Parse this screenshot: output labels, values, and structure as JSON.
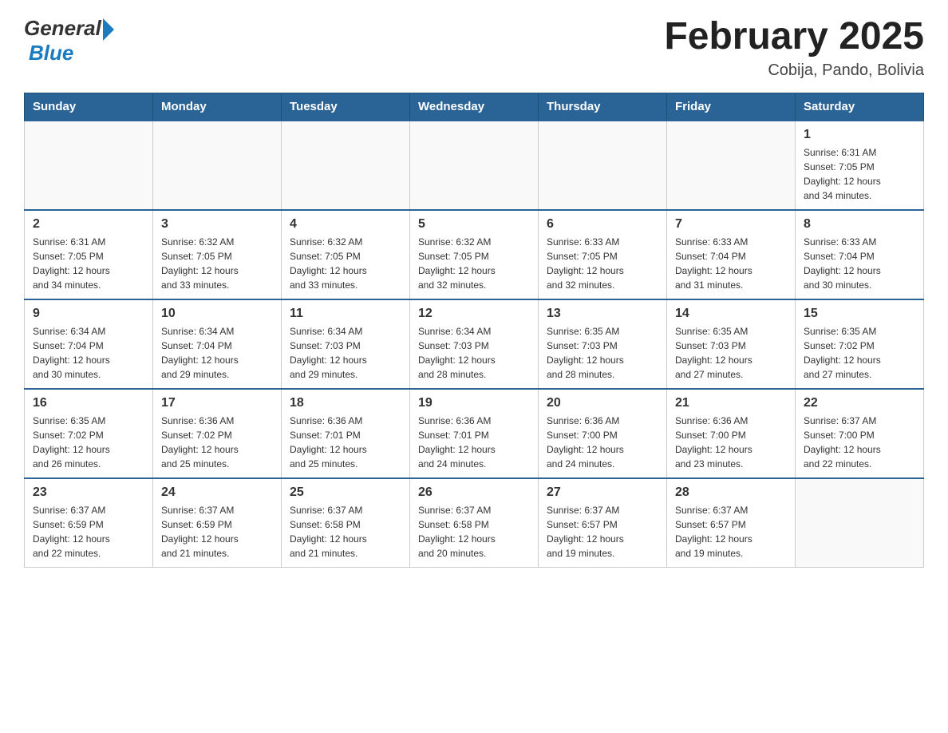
{
  "logo": {
    "general": "General",
    "blue": "Blue"
  },
  "title": "February 2025",
  "subtitle": "Cobija, Pando, Bolivia",
  "weekdays": [
    "Sunday",
    "Monday",
    "Tuesday",
    "Wednesday",
    "Thursday",
    "Friday",
    "Saturday"
  ],
  "weeks": [
    [
      {
        "day": "",
        "info": ""
      },
      {
        "day": "",
        "info": ""
      },
      {
        "day": "",
        "info": ""
      },
      {
        "day": "",
        "info": ""
      },
      {
        "day": "",
        "info": ""
      },
      {
        "day": "",
        "info": ""
      },
      {
        "day": "1",
        "info": "Sunrise: 6:31 AM\nSunset: 7:05 PM\nDaylight: 12 hours\nand 34 minutes."
      }
    ],
    [
      {
        "day": "2",
        "info": "Sunrise: 6:31 AM\nSunset: 7:05 PM\nDaylight: 12 hours\nand 34 minutes."
      },
      {
        "day": "3",
        "info": "Sunrise: 6:32 AM\nSunset: 7:05 PM\nDaylight: 12 hours\nand 33 minutes."
      },
      {
        "day": "4",
        "info": "Sunrise: 6:32 AM\nSunset: 7:05 PM\nDaylight: 12 hours\nand 33 minutes."
      },
      {
        "day": "5",
        "info": "Sunrise: 6:32 AM\nSunset: 7:05 PM\nDaylight: 12 hours\nand 32 minutes."
      },
      {
        "day": "6",
        "info": "Sunrise: 6:33 AM\nSunset: 7:05 PM\nDaylight: 12 hours\nand 32 minutes."
      },
      {
        "day": "7",
        "info": "Sunrise: 6:33 AM\nSunset: 7:04 PM\nDaylight: 12 hours\nand 31 minutes."
      },
      {
        "day": "8",
        "info": "Sunrise: 6:33 AM\nSunset: 7:04 PM\nDaylight: 12 hours\nand 30 minutes."
      }
    ],
    [
      {
        "day": "9",
        "info": "Sunrise: 6:34 AM\nSunset: 7:04 PM\nDaylight: 12 hours\nand 30 minutes."
      },
      {
        "day": "10",
        "info": "Sunrise: 6:34 AM\nSunset: 7:04 PM\nDaylight: 12 hours\nand 29 minutes."
      },
      {
        "day": "11",
        "info": "Sunrise: 6:34 AM\nSunset: 7:03 PM\nDaylight: 12 hours\nand 29 minutes."
      },
      {
        "day": "12",
        "info": "Sunrise: 6:34 AM\nSunset: 7:03 PM\nDaylight: 12 hours\nand 28 minutes."
      },
      {
        "day": "13",
        "info": "Sunrise: 6:35 AM\nSunset: 7:03 PM\nDaylight: 12 hours\nand 28 minutes."
      },
      {
        "day": "14",
        "info": "Sunrise: 6:35 AM\nSunset: 7:03 PM\nDaylight: 12 hours\nand 27 minutes."
      },
      {
        "day": "15",
        "info": "Sunrise: 6:35 AM\nSunset: 7:02 PM\nDaylight: 12 hours\nand 27 minutes."
      }
    ],
    [
      {
        "day": "16",
        "info": "Sunrise: 6:35 AM\nSunset: 7:02 PM\nDaylight: 12 hours\nand 26 minutes."
      },
      {
        "day": "17",
        "info": "Sunrise: 6:36 AM\nSunset: 7:02 PM\nDaylight: 12 hours\nand 25 minutes."
      },
      {
        "day": "18",
        "info": "Sunrise: 6:36 AM\nSunset: 7:01 PM\nDaylight: 12 hours\nand 25 minutes."
      },
      {
        "day": "19",
        "info": "Sunrise: 6:36 AM\nSunset: 7:01 PM\nDaylight: 12 hours\nand 24 minutes."
      },
      {
        "day": "20",
        "info": "Sunrise: 6:36 AM\nSunset: 7:00 PM\nDaylight: 12 hours\nand 24 minutes."
      },
      {
        "day": "21",
        "info": "Sunrise: 6:36 AM\nSunset: 7:00 PM\nDaylight: 12 hours\nand 23 minutes."
      },
      {
        "day": "22",
        "info": "Sunrise: 6:37 AM\nSunset: 7:00 PM\nDaylight: 12 hours\nand 22 minutes."
      }
    ],
    [
      {
        "day": "23",
        "info": "Sunrise: 6:37 AM\nSunset: 6:59 PM\nDaylight: 12 hours\nand 22 minutes."
      },
      {
        "day": "24",
        "info": "Sunrise: 6:37 AM\nSunset: 6:59 PM\nDaylight: 12 hours\nand 21 minutes."
      },
      {
        "day": "25",
        "info": "Sunrise: 6:37 AM\nSunset: 6:58 PM\nDaylight: 12 hours\nand 21 minutes."
      },
      {
        "day": "26",
        "info": "Sunrise: 6:37 AM\nSunset: 6:58 PM\nDaylight: 12 hours\nand 20 minutes."
      },
      {
        "day": "27",
        "info": "Sunrise: 6:37 AM\nSunset: 6:57 PM\nDaylight: 12 hours\nand 19 minutes."
      },
      {
        "day": "28",
        "info": "Sunrise: 6:37 AM\nSunset: 6:57 PM\nDaylight: 12 hours\nand 19 minutes."
      },
      {
        "day": "",
        "info": ""
      }
    ]
  ],
  "colors": {
    "header_bg": "#2a6496",
    "header_text": "#ffffff",
    "border": "#2a6496"
  }
}
